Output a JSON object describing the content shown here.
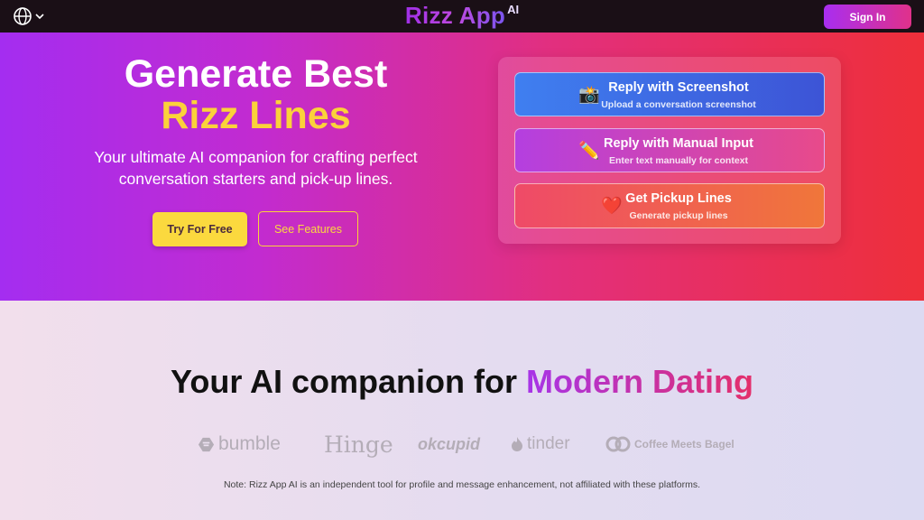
{
  "header": {
    "brand_name": "Rizz App",
    "brand_suffix": "AI",
    "sign_in_label": "Sign In",
    "language_icon": "globe-icon",
    "language_caret_icon": "chevron-down-icon"
  },
  "hero": {
    "title_line1": "Generate Best",
    "title_line2": "Rizz Lines",
    "subtitle_line1": "Your ultimate AI companion for crafting perfect",
    "subtitle_line2": "conversation starters and pick-up lines.",
    "primary_button": "Try For Free",
    "secondary_button": "See Features"
  },
  "options": [
    {
      "icon": "📸",
      "icon_name": "camera-icon",
      "title": "Reply with Screenshot",
      "description": "Upload a conversation screenshot"
    },
    {
      "icon": "✏️",
      "icon_name": "pencil-icon",
      "title": "Reply with Manual Input",
      "description": "Enter text manually for context"
    },
    {
      "icon": "❤️",
      "icon_name": "heart-icon",
      "title": "Get Pickup Lines",
      "description": "Generate pickup lines"
    }
  ],
  "section": {
    "heading_plain": "Your AI companion for",
    "heading_highlight": "Modern Dating",
    "logos": [
      "bumble",
      "Hinge",
      "okcupid",
      "tinder",
      "Coffee Meets Bagel"
    ],
    "note": "Note: Rizz App AI is an independent tool for profile and message enhancement, not affiliated with these platforms."
  },
  "colors": {
    "accent_yellow": "#fbd23a",
    "hero_gradient_start": "#a42df0",
    "hero_gradient_end": "#ee2f3a",
    "topbar": "#1a0f16"
  }
}
